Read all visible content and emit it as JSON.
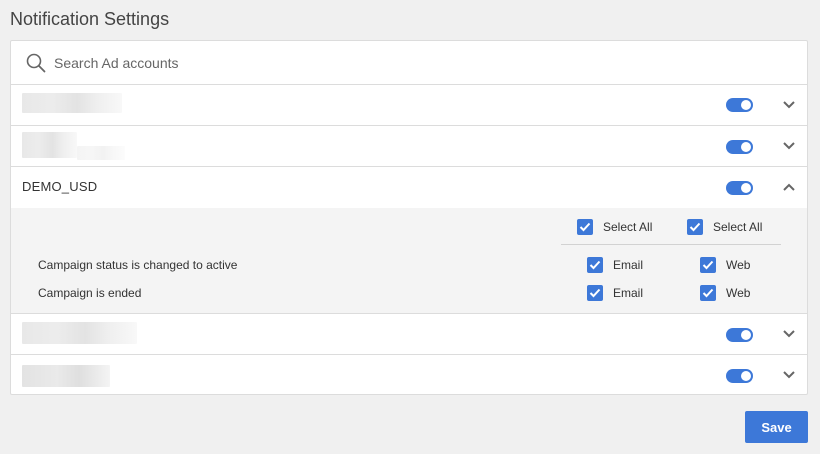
{
  "page": {
    "title": "Notification Settings"
  },
  "search": {
    "placeholder": "Search Ad accounts"
  },
  "accounts": [
    {
      "name": "",
      "obscured": true,
      "enabled": true,
      "expanded": false
    },
    {
      "name": "",
      "obscured": true,
      "enabled": true,
      "expanded": false
    },
    {
      "name": "DEMO_USD",
      "obscured": false,
      "enabled": true,
      "expanded": true
    },
    {
      "name": "",
      "obscured": true,
      "enabled": true,
      "expanded": false
    },
    {
      "name": "",
      "obscured": true,
      "enabled": true,
      "expanded": false
    }
  ],
  "demo_settings": {
    "select_all_email_label": "Select All",
    "select_all_web_label": "Select All",
    "rows": [
      {
        "label": "Campaign status is changed to active",
        "email_label": "Email",
        "web_label": "Web",
        "email_checked": true,
        "web_checked": true
      },
      {
        "label": "Campaign is ended",
        "email_label": "Email",
        "web_label": "Web",
        "email_checked": true,
        "web_checked": true
      }
    ]
  },
  "actions": {
    "save_label": "Save"
  },
  "colors": {
    "accent": "#3d78d8",
    "background": "#f0f0f0",
    "expanded_bg": "#f4f4f4"
  }
}
